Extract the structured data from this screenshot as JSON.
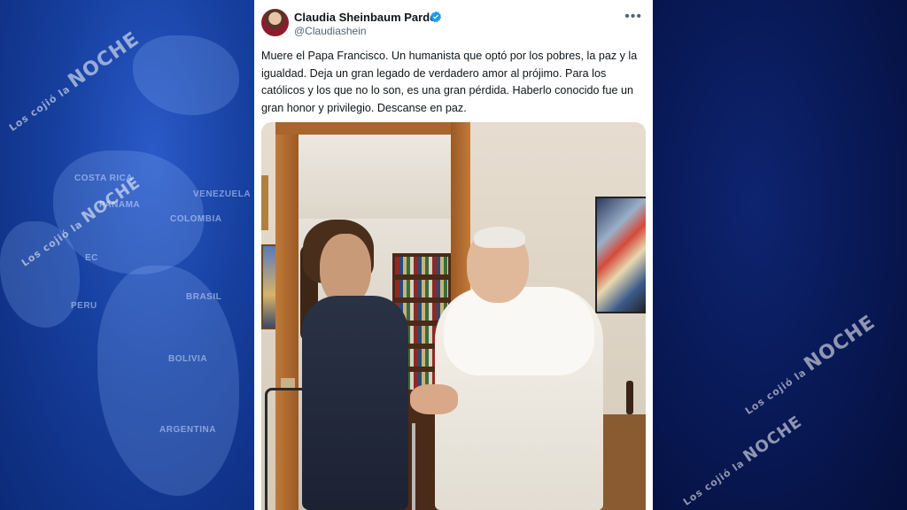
{
  "tweet": {
    "author_name": "Claudia Sheinbaum Pardo",
    "handle": "@Claudiashein",
    "more_icon": "more-horizontal-icon",
    "verified_icon": "verified-badge-icon",
    "text": "Muere el Papa Francisco. Un humanista que optó por los pobres, la paz y la igualdad. Deja un gran legado de verdadero amor al prójimo. Para los católicos y los que no lo son, es una gran pérdida. Haberlo conocido fue un gran honor y privilegio. Descanse en paz."
  },
  "watermark": {
    "small": "Los cojió la",
    "large": "NOCHE"
  },
  "map_labels": [
    "COSTA RICA",
    "PANAMA",
    "COLOMBIA",
    "VENEZUELA",
    "EC",
    "PERU",
    "BRASIL",
    "BOLIVIA",
    "ARGENTINA"
  ],
  "colors": {
    "left_bg": "#163f9e",
    "right_bg": "#081854",
    "verified": "#1d9bf0"
  }
}
